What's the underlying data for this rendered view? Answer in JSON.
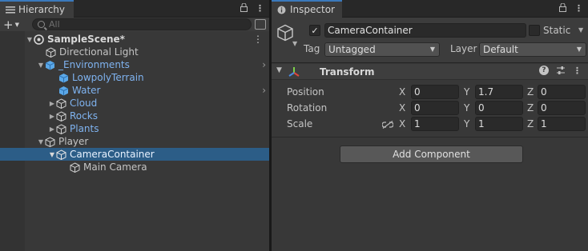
{
  "hierarchy": {
    "tab_title": "Hierarchy",
    "search_placeholder": "All",
    "items": [
      {
        "label": "SampleScene*",
        "kind": "scene"
      },
      {
        "label": "Directional Light",
        "kind": "object"
      },
      {
        "label": "_Environments",
        "kind": "prefab"
      },
      {
        "label": "LowpolyTerrain",
        "kind": "prefab"
      },
      {
        "label": "Water",
        "kind": "prefab"
      },
      {
        "label": "Cloud",
        "kind": "prefab"
      },
      {
        "label": "Rocks",
        "kind": "prefab"
      },
      {
        "label": "Plants",
        "kind": "prefab"
      },
      {
        "label": "Player",
        "kind": "object"
      },
      {
        "label": "CameraContainer",
        "kind": "prefab",
        "selected": true
      },
      {
        "label": "Main Camera",
        "kind": "object"
      }
    ]
  },
  "inspector": {
    "tab_title": "Inspector",
    "object_name": "CameraContainer",
    "active": true,
    "static_label": "Static",
    "tag_label": "Tag",
    "tag_value": "Untagged",
    "layer_label": "Layer",
    "layer_value": "Default",
    "component_title": "Transform",
    "transform": {
      "position": {
        "label": "Position",
        "x": "0",
        "y": "1.7",
        "z": "0"
      },
      "rotation": {
        "label": "Rotation",
        "x": "0",
        "y": "0",
        "z": "0"
      },
      "scale": {
        "label": "Scale",
        "x": "1",
        "y": "1",
        "z": "1"
      }
    },
    "axis_labels": {
      "x": "X",
      "y": "Y",
      "z": "Z"
    },
    "add_component_label": "Add Component"
  },
  "colors": {
    "prefab_text": "#7fb3f0",
    "selection": "#2c5d87",
    "tab_accent": "#3a79bb"
  }
}
